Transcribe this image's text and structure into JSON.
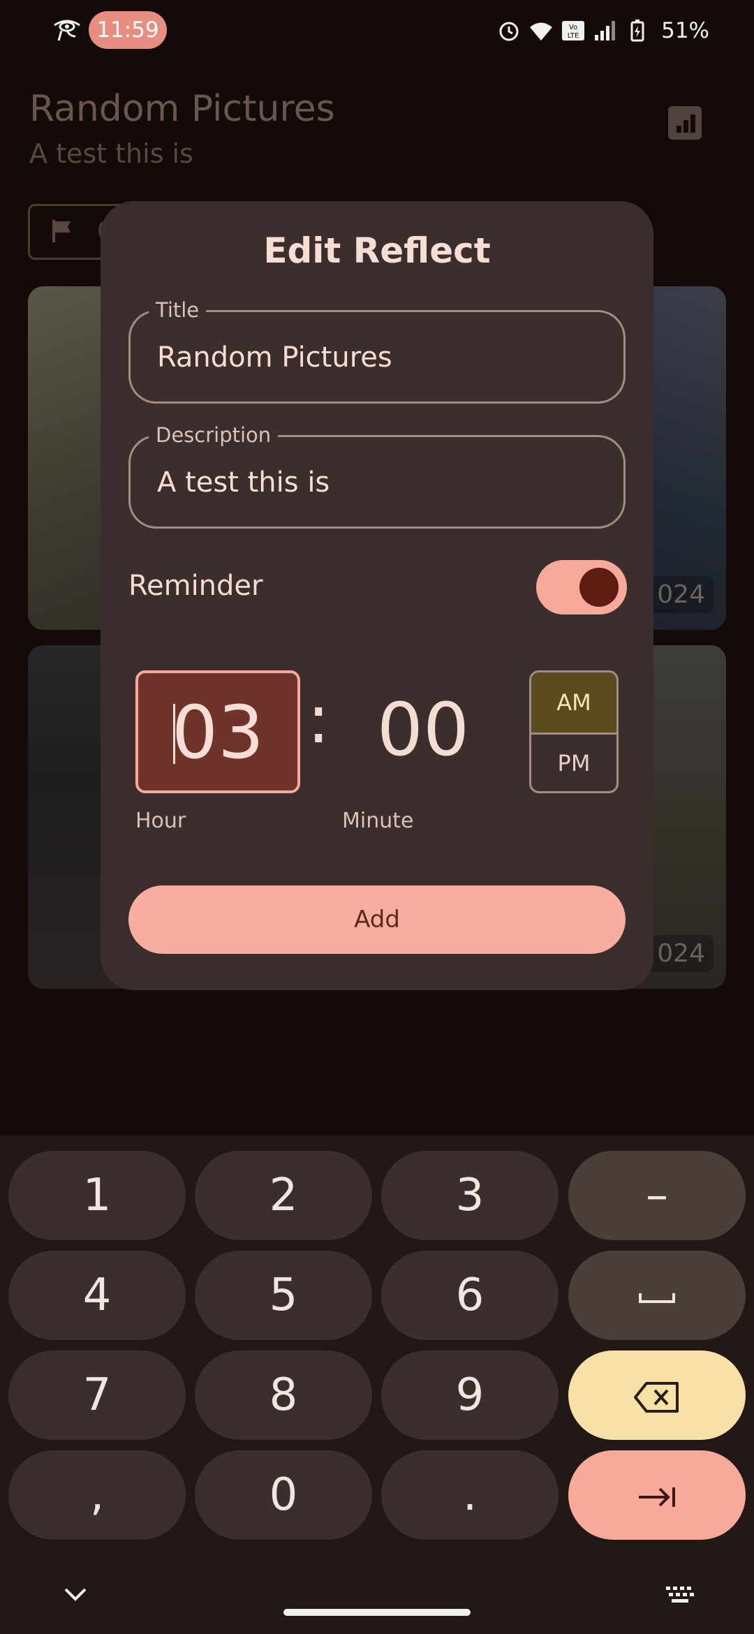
{
  "status_bar": {
    "time": "11:59",
    "battery": "51%",
    "icons": [
      "eye-icon",
      "alarm-icon",
      "wifi-icon",
      "volte-icon",
      "signal-icon",
      "battery-icon"
    ]
  },
  "background": {
    "title": "Random Pictures",
    "subtitle": "A test this is",
    "chip_text": "0",
    "card_dates": [
      "024",
      "024"
    ]
  },
  "dialog": {
    "title": "Edit Reflect",
    "title_field": {
      "label": "Title",
      "value": "Random Pictures"
    },
    "description_field": {
      "label": "Description",
      "value": "A test this is"
    },
    "reminder_label": "Reminder",
    "reminder_on": true,
    "hour": "03",
    "minute": "00",
    "separator": ":",
    "hour_label": "Hour",
    "minute_label": "Minute",
    "am_label": "AM",
    "pm_label": "PM",
    "selected_period": "AM",
    "add_label": "Add"
  },
  "keyboard": {
    "rows": [
      [
        "1",
        "2",
        "3",
        "–"
      ],
      [
        "4",
        "5",
        "6",
        "space"
      ],
      [
        "7",
        "8",
        "9",
        "backspace"
      ],
      [
        ",",
        "0",
        ".",
        "tab"
      ]
    ]
  },
  "colors": {
    "accent": "#f7ad9f",
    "dialog_bg": "#3c2e2c",
    "selected_am": "#5a4c1e",
    "delete_key": "#f8e1a7"
  }
}
